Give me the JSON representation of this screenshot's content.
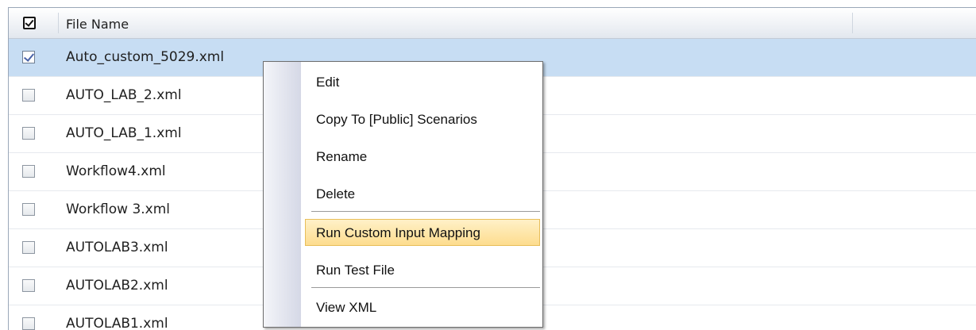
{
  "grid": {
    "header": {
      "file_name_label": "File Name"
    },
    "rows": [
      {
        "name": "Auto_custom_5029.xml",
        "checked": true
      },
      {
        "name": "AUTO_LAB_2.xml",
        "checked": false
      },
      {
        "name": "AUTO_LAB_1.xml",
        "checked": false
      },
      {
        "name": "Workflow4.xml",
        "checked": false
      },
      {
        "name": "Workflow 3.xml",
        "checked": false
      },
      {
        "name": "AUTOLAB3.xml",
        "checked": false
      },
      {
        "name": "AUTOLAB2.xml",
        "checked": false
      },
      {
        "name": "AUTOLAB1.xml",
        "checked": false
      }
    ]
  },
  "context_menu": {
    "items": [
      {
        "label": "Edit"
      },
      {
        "label": "Copy To [Public] Scenarios"
      },
      {
        "label": "Rename"
      },
      {
        "label": "Delete"
      },
      {
        "label": "Run Custom Input Mapping",
        "highlighted": true
      },
      {
        "label": "Run Test File"
      },
      {
        "label": "View XML"
      }
    ]
  },
  "colors": {
    "selection": "#c7ddf3",
    "menu_highlight": "#fddc8e",
    "menu_highlight_border": "#e8be5a"
  }
}
